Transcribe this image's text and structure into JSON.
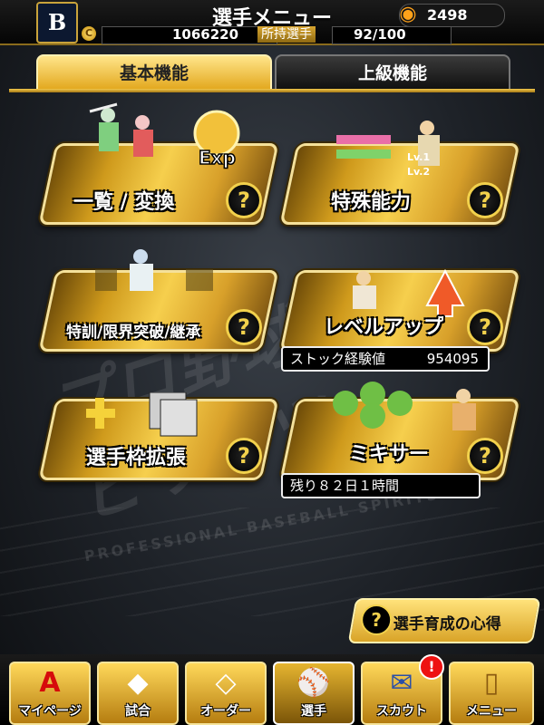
{
  "header": {
    "team_logo": "B",
    "title": "選手メニュー",
    "gold_icon": "flame-coin-icon",
    "gold_count": "2498",
    "coin_count": "1066220",
    "owned_label": "所持選手",
    "owned_value": "92/100"
  },
  "tabs": [
    {
      "label": "基本機能",
      "active": true
    },
    {
      "label": "上級機能",
      "active": false
    }
  ],
  "menu": {
    "list_convert": {
      "label": "一覧 / 変換",
      "exp": "Exp"
    },
    "special_ability": {
      "label": "特殊能力",
      "lv1": "Lv.1",
      "lv2": "Lv.2"
    },
    "training": {
      "label": "特訓/限界突破/継承"
    },
    "level_up": {
      "label": "レベルアップ",
      "stock_label": "ストック経験値",
      "stock_value": "954095"
    },
    "expand_slots": {
      "label": "選手枠拡張"
    },
    "mixer": {
      "label": "ミキサー",
      "remaining": "残り８２日１時間"
    }
  },
  "tip": {
    "label": "選手育成の心得",
    "q": "?"
  },
  "help_symbol": "?",
  "nav": [
    {
      "label": "マイページ",
      "icon": "A"
    },
    {
      "label": "試合",
      "icon": "◆"
    },
    {
      "label": "オーダー",
      "icon": "◇"
    },
    {
      "label": "選手",
      "icon": "⚾"
    },
    {
      "label": "スカウト",
      "icon": "✉",
      "badge": "!"
    },
    {
      "label": "メニュー",
      "icon": "▯"
    }
  ],
  "background": {
    "title": "プロ野球スピリッツ",
    "sub": "PROFESSIONAL BASEBALL SPIRITS"
  }
}
